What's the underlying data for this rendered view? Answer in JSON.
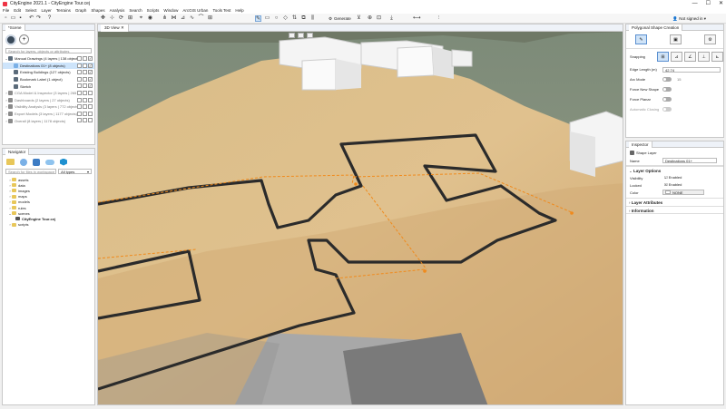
{
  "window": {
    "title": "CityEngine 2021.1 - CityEngine Tour.cej",
    "minimize": "—",
    "maximize": "☐",
    "close": "✕"
  },
  "menu": [
    "File",
    "Edit",
    "Select",
    "Layer",
    "Terrains",
    "Graph",
    "Shapes",
    "Analysis",
    "Search",
    "Scripts",
    "Window",
    "ArcGIS Urban",
    "Tools Test",
    "Help"
  ],
  "toolbar": {
    "generate_label": "Generate",
    "signin_label": "Not signed in"
  },
  "scene": {
    "tab": "*Scene",
    "search_placeholder": "Search for layers, objects or attributes",
    "rows": [
      {
        "label": "Manual Drawings (4 layers | 138 objects)",
        "indent": 0
      },
      {
        "label": "Destinations 01+ (8 objects)",
        "indent": 1
      },
      {
        "label": "Existing Buildings (127 objects)",
        "indent": 1
      },
      {
        "label": "Bookmark Label (1 object)",
        "indent": 1
      },
      {
        "label": "Sketch",
        "indent": 1
      },
      {
        "label": "CGA Model & Inspector (3 layers | 265 )",
        "indent": 0
      },
      {
        "label": "Dashboards (2 layers | 27 objects)",
        "indent": 0
      },
      {
        "label": "Visibility Analysis (3 layers | 772 objects)",
        "indent": 0
      },
      {
        "label": "Export Models (3 layers | 1177 objects)",
        "indent": 0
      },
      {
        "label": "Overall (8 layers | 1178 objects)",
        "indent": 0
      }
    ]
  },
  "navigator": {
    "tab": "Navigator",
    "search_placeholder": "Search for files in workspace",
    "filter_value": "All types",
    "items": [
      {
        "label": "assets",
        "indent": 1,
        "type": "folder"
      },
      {
        "label": "data",
        "indent": 1,
        "type": "folder"
      },
      {
        "label": "images",
        "indent": 1,
        "type": "folder"
      },
      {
        "label": "maps",
        "indent": 1,
        "type": "folder"
      },
      {
        "label": "models",
        "indent": 1,
        "type": "folder"
      },
      {
        "label": "rules",
        "indent": 1,
        "type": "folder"
      },
      {
        "label": "scenes",
        "indent": 1,
        "type": "folder"
      },
      {
        "label": "CityEngine Tour.cej",
        "indent": 2,
        "type": "file"
      },
      {
        "label": "scripts",
        "indent": 1,
        "type": "folder"
      }
    ]
  },
  "viewport": {
    "tab": "3D View",
    "close": "✕"
  },
  "polygonal": {
    "tab": "Polygonal Shape Creation",
    "snapping_label": "Snapping",
    "edge_length_label": "Edge Length (m)",
    "edge_length_value": "42.74",
    "arc_mode_label": "Arc Mode",
    "arc_value": "15",
    "force_new_label": "Force New Shape",
    "force_planar_label": "Force Planar",
    "auto_closing_label": "Automatic Closing"
  },
  "inspector": {
    "tab": "Inspector",
    "shape_type": "Shape Layer",
    "name_label": "Name",
    "name_value": "Destinations 01+",
    "layer_options": "Layer Options",
    "visibility_label": "Visibility",
    "visibility_value": "Enabled",
    "locked_label": "Locked",
    "locked_value": "Enabled",
    "color_label": "Color",
    "color_value": "NONE",
    "layer_attributes": "Layer Attributes",
    "information": "Information"
  },
  "colors": {
    "terrain": "#d8b782",
    "outline": "#2b2b2b",
    "highlight": "#f08a1c",
    "selection": "#cde4fb"
  }
}
